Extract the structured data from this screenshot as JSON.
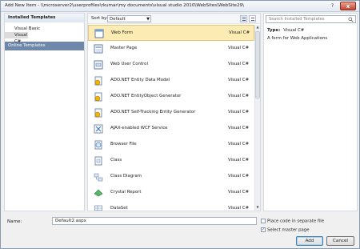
{
  "window": {
    "title": "Add New Item - \\\\mcroserver2\\userprofiles\\rkumar\\my documents\\visual studio 2010\\WebSites\\WebSite29\\",
    "help_label": "?",
    "close_label": "x"
  },
  "left": {
    "installed_label": "Installed Templates",
    "items": [
      {
        "label": "Visual Basic"
      },
      {
        "label": "Visual C#"
      }
    ],
    "online_label": "Online Templates"
  },
  "sortbar": {
    "label": "Sort by:",
    "selected": "Default"
  },
  "templates": [
    {
      "name": "Web Form",
      "lang": "Visual C#",
      "icon": "web-form-icon",
      "selected": true
    },
    {
      "name": "Master Page",
      "lang": "Visual C#",
      "icon": "master-page-icon"
    },
    {
      "name": "Web User Control",
      "lang": "Visual C#",
      "icon": "user-control-icon"
    },
    {
      "name": "ADO.NET Entity Data Model",
      "lang": "Visual C#",
      "icon": "entity-model-icon"
    },
    {
      "name": "ADO.NET EntityObject Generator",
      "lang": "Visual C#",
      "icon": "entity-generator-icon"
    },
    {
      "name": "ADO.NET Self-Tracking Entity Generator",
      "lang": "Visual C#",
      "icon": "self-tracking-generator-icon"
    },
    {
      "name": "AJAX-enabled WCF Service",
      "lang": "Visual C#",
      "icon": "wcf-service-icon"
    },
    {
      "name": "Browser File",
      "lang": "Visual C#",
      "icon": "browser-file-icon"
    },
    {
      "name": "Class",
      "lang": "Visual C#",
      "icon": "class-icon"
    },
    {
      "name": "Class Diagram",
      "lang": "Visual C#",
      "icon": "class-diagram-icon"
    },
    {
      "name": "Crystal Report",
      "lang": "Visual C#",
      "icon": "crystal-report-icon"
    },
    {
      "name": "DataSet",
      "lang": "Visual C#",
      "icon": "dataset-icon"
    }
  ],
  "details": {
    "search_placeholder": "Search Installed Templates",
    "type_label": "Type:",
    "type_value": "Visual C#",
    "description": "A form for Web Applications"
  },
  "form": {
    "name_label": "Name:",
    "name_value": "Default2.aspx",
    "option_separate_label": "Place code in separate file",
    "option_separate_checked": false,
    "option_master_label": "Select master page",
    "option_master_checked": true,
    "add_label": "Add",
    "cancel_label": "Cancel"
  }
}
